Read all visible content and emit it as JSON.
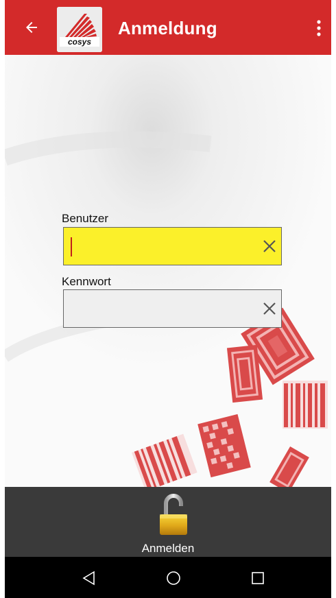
{
  "app_bar": {
    "title": "Anmeldung",
    "back_icon": "arrow-left-icon",
    "menu_icon": "more-vert-icon",
    "logo_text": "cosys",
    "color": "#d32a2a"
  },
  "form": {
    "username": {
      "label": "Benutzer",
      "value": "",
      "placeholder": "",
      "background": "#fbf02a",
      "clear_icon": "close-icon"
    },
    "password": {
      "label": "Kennwort",
      "value": "",
      "placeholder": "",
      "background": "#efefef",
      "clear_icon": "close-icon"
    }
  },
  "action_bar": {
    "login_label": "Anmelden",
    "login_icon": "padlock-open-icon"
  },
  "system_nav": {
    "back_icon": "nav-back-icon",
    "home_icon": "nav-home-icon",
    "recents_icon": "nav-recents-icon"
  }
}
